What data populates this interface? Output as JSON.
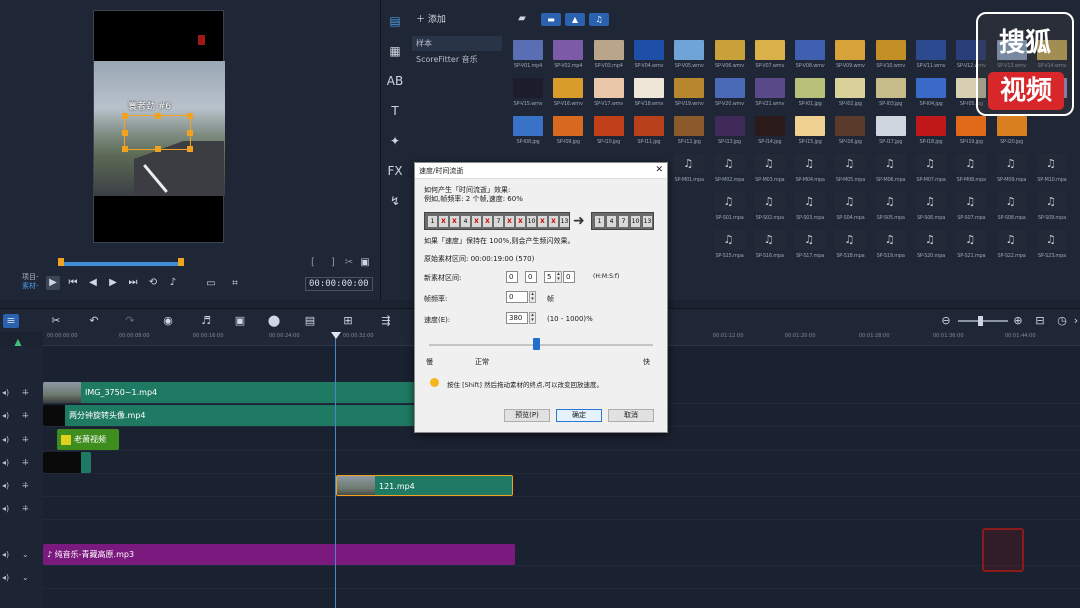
{
  "preview": {
    "overlay_text": "寰者劲 #6",
    "tc_label_project": "项目-",
    "tc_label_clip": "素材-",
    "timecode": "00:00:00:00"
  },
  "library": {
    "add_label": "添加",
    "side_items": [
      "样本",
      "ScoreFitter 音乐"
    ],
    "thumbs": [
      {
        "cap": "SP-V01.mp4",
        "c": "#5a6fb3"
      },
      {
        "cap": "SP-V02.mp4",
        "c": "#7d5aa8"
      },
      {
        "cap": "SP-V03.mp4",
        "c": "#b9a58a"
      },
      {
        "cap": "SP-V04.wmv",
        "c": "#1d4ea8"
      },
      {
        "cap": "SP-V05.wmv",
        "c": "#6fa4d6"
      },
      {
        "cap": "SP-V06.wmv",
        "c": "#c9a13a"
      },
      {
        "cap": "SP-V07.wmv",
        "c": "#d8b248"
      },
      {
        "cap": "SP-V08.wmv",
        "c": "#3f5fb1"
      },
      {
        "cap": "SP-V09.wmv",
        "c": "#d6a23a"
      },
      {
        "cap": "SP-V10.wmv",
        "c": "#c49026"
      },
      {
        "cap": "SP-V11.wmv",
        "c": "#2c4a90"
      },
      {
        "cap": "SP-V12.wmv",
        "c": "#2a3e7a"
      },
      {
        "cap": "SP-V13.wmv",
        "c": "#9ab3d6"
      },
      {
        "cap": "SP-V14.wmv",
        "c": "#d9b960"
      },
      {
        "cap": "SP-V15.wmv",
        "c": "#1c1c2a"
      },
      {
        "cap": "SP-V16.wmv",
        "c": "#d89c2a"
      },
      {
        "cap": "SP-V17.wmv",
        "c": "#e8c8a8"
      },
      {
        "cap": "SP-V18.wmv",
        "c": "#f0e6d8"
      },
      {
        "cap": "SP-V19.wmv",
        "c": "#b8862c"
      },
      {
        "cap": "SP-V20.wmv",
        "c": "#4a6ab8"
      },
      {
        "cap": "SP-V21.wmv",
        "c": "#5a4a8a"
      },
      {
        "cap": "SP-I01.jpg",
        "c": "#b8c07a"
      },
      {
        "cap": "SP-I02.jpg",
        "c": "#d9d09a"
      },
      {
        "cap": "SP-I03.jpg",
        "c": "#c7bd8a"
      },
      {
        "cap": "SP-I04.jpg",
        "c": "#3a6ac8"
      },
      {
        "cap": "SP-I05.jpg",
        "c": "#d8d0b0"
      },
      {
        "cap": "SP-I06.jpg",
        "c": "#8ab0e0"
      },
      {
        "cap": "SP-I07.jpg",
        "c": "#b9a0d0"
      },
      {
        "cap": "SP-I08.jpg",
        "c": "#3a72c8"
      },
      {
        "cap": "SP-I09.jpg",
        "c": "#d86a20"
      },
      {
        "cap": "SP-I10.jpg",
        "c": "#c0401a"
      },
      {
        "cap": "SP-I11.jpg",
        "c": "#b8401a"
      },
      {
        "cap": "SP-I12.jpg",
        "c": "#8a5a2a"
      },
      {
        "cap": "SP-I13.jpg",
        "c": "#402a5a"
      },
      {
        "cap": "SP-I14.jpg",
        "c": "#2a1a1a"
      },
      {
        "cap": "SP-I15.jpg",
        "c": "#f0d090"
      },
      {
        "cap": "SP-I16.jpg",
        "c": "#5a3a2a"
      },
      {
        "cap": "SP-I17.jpg",
        "c": "#cfd6e0"
      },
      {
        "cap": "SP-I18.jpg",
        "c": "#c01818"
      },
      {
        "cap": "SP-I19.jpg",
        "c": "#e06a1a"
      },
      {
        "cap": "SP-I20.jpg",
        "c": "#d88020"
      },
      {
        "cap": "SP-M01.mpa",
        "c": "audio"
      },
      {
        "cap": "SP-M02.mpa",
        "c": "audio"
      },
      {
        "cap": "SP-M03.mpa",
        "c": "audio"
      },
      {
        "cap": "SP-M04.mpa",
        "c": "audio"
      },
      {
        "cap": "SP-M05.mpa",
        "c": "audio"
      },
      {
        "cap": "SP-M06.mpa",
        "c": "audio"
      },
      {
        "cap": "SP-M07.mpa",
        "c": "audio"
      },
      {
        "cap": "SP-M08.mpa",
        "c": "audio"
      },
      {
        "cap": "SP-M09.mpa",
        "c": "audio"
      },
      {
        "cap": "SP-M10.mpa",
        "c": "audio"
      },
      {
        "cap": "SP-S01.mpa",
        "c": "audio"
      },
      {
        "cap": "SP-S02.mpa",
        "c": "audio"
      },
      {
        "cap": "SP-S03.mpa",
        "c": "audio"
      },
      {
        "cap": "SP-S04.mpa",
        "c": "audio"
      },
      {
        "cap": "SP-S05.mpa",
        "c": "audio"
      },
      {
        "cap": "SP-S06.mpa",
        "c": "audio"
      },
      {
        "cap": "SP-S07.mpa",
        "c": "audio"
      },
      {
        "cap": "SP-S08.mpa",
        "c": "audio"
      },
      {
        "cap": "SP-S09.mpa",
        "c": "audio"
      },
      {
        "cap": "SP-S15.mpa",
        "c": "audio"
      },
      {
        "cap": "SP-S16.mpa",
        "c": "audio"
      },
      {
        "cap": "SP-S17.mpa",
        "c": "audio"
      },
      {
        "cap": "SP-S18.mpa",
        "c": "audio"
      },
      {
        "cap": "SP-S19.mpa",
        "c": "audio"
      },
      {
        "cap": "SP-S20.mpa",
        "c": "audio"
      },
      {
        "cap": "SP-S21.mpa",
        "c": "audio"
      },
      {
        "cap": "SP-S22.mpa",
        "c": "audio"
      },
      {
        "cap": "SP-S23.mpa",
        "c": "audio"
      }
    ]
  },
  "watermark": {
    "top": "搜狐",
    "bottom": "视频"
  },
  "ruler_ticks": [
    "00:00:00:00",
    "00:00:08:00",
    "00:00:16:00",
    "00:00:24:00",
    "00:00:32:00",
    "00:01:12:00",
    "00:01:20:00",
    "00:01:28:00",
    "00:01:36:00",
    "00:01:44:00"
  ],
  "clips": {
    "video1": "IMG_3750~1.mp4",
    "overlay1": "两分钟旋转头像.mp4",
    "title1": "老萧视频",
    "overlay3": "121.mp4",
    "audio": "纯音乐-青藏高原.mp3"
  },
  "dialog": {
    "title": "速度/时间流逝",
    "close": "✕",
    "line1": "如何产生「时间流逝」效果:",
    "line2": "例如,帧频率: 2 个帧,速度: 60%",
    "film_cells": [
      "1",
      "X",
      "X",
      "4",
      "X",
      "X",
      "7",
      "X",
      "X",
      "10",
      "X",
      "X",
      "13"
    ],
    "film2_cells": [
      "1",
      "4",
      "7",
      "10",
      "13"
    ],
    "line3": "如果「速度」保持在 100%,则会产生频闪效果。",
    "orig_label": "原始素材区间: 00:00:19:00 (570)",
    "new_label": "新素材区间:",
    "new_vals": [
      "0",
      "0",
      "5",
      "0"
    ],
    "hmsf": "(H:M:S:f)",
    "fps_label": "帧频率:",
    "fps_val": "0",
    "fps_unit": "帧",
    "speed_label": "速度(E):",
    "speed_val": "380",
    "speed_range": "(10 - 1000)%",
    "slow": "慢",
    "normal": "正常",
    "fast": "快",
    "tip": "按住 [Shift] 然后拖动素材的终点,可以改变回放速度。",
    "preview_btn": "预览(P)",
    "ok_btn": "确定",
    "cancel_btn": "取消",
    "speed_percent_position": 0.4
  }
}
